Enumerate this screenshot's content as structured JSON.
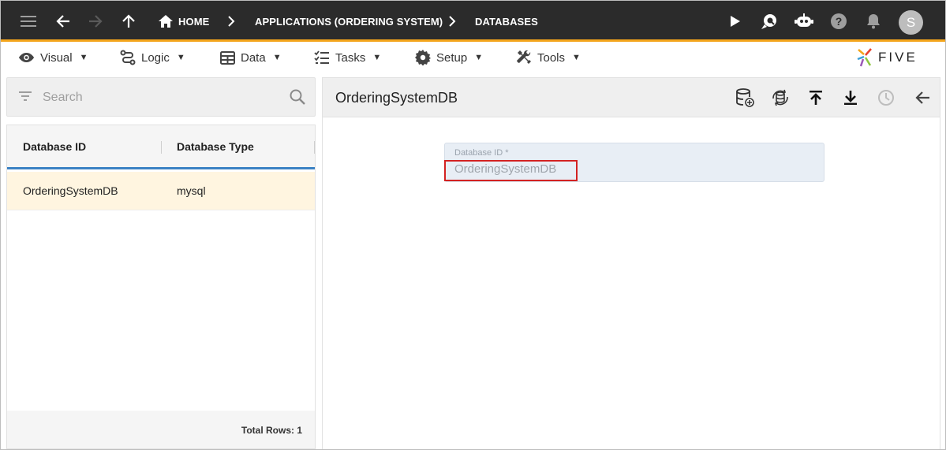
{
  "appbar": {
    "breadcrumbs": [
      "HOME",
      "APPLICATIONS (ORDERING SYSTEM)",
      "DATABASES"
    ],
    "avatar_initial": "S",
    "accent_color": "#f4a51c",
    "icons": [
      "menu-icon",
      "back-arrow-icon",
      "forward-arrow-icon",
      "up-arrow-icon",
      "home-icon",
      "play-icon",
      "search-bubble-icon",
      "chat-bot-icon",
      "help-icon",
      "bell-icon"
    ]
  },
  "menu": {
    "items": [
      {
        "label": "Visual",
        "icon": "eye-icon"
      },
      {
        "label": "Logic",
        "icon": "logic-icon"
      },
      {
        "label": "Data",
        "icon": "table-icon"
      },
      {
        "label": "Tasks",
        "icon": "tasks-icon"
      },
      {
        "label": "Setup",
        "icon": "gear-icon"
      },
      {
        "label": "Tools",
        "icon": "tools-icon"
      }
    ],
    "caret": "▼",
    "logo_text": "FIVE"
  },
  "search": {
    "placeholder": "Search"
  },
  "grid": {
    "columns": [
      "Database ID",
      "Database Type"
    ],
    "rows": [
      {
        "database_id": "OrderingSystemDB",
        "database_type": "mysql"
      }
    ],
    "total_label": "Total Rows: 1",
    "selected_color": "#fff5e0",
    "header_rule_color": "#3b82c4"
  },
  "detail": {
    "title": "OrderingSystemDB",
    "toolbar": [
      "database-add-icon",
      "database-sync-icon",
      "upload-icon",
      "download-icon",
      "history-icon",
      "back-icon"
    ],
    "field": {
      "label": "Database ID *",
      "value": "OrderingSystemDB"
    },
    "highlight_color": "#d32222"
  }
}
